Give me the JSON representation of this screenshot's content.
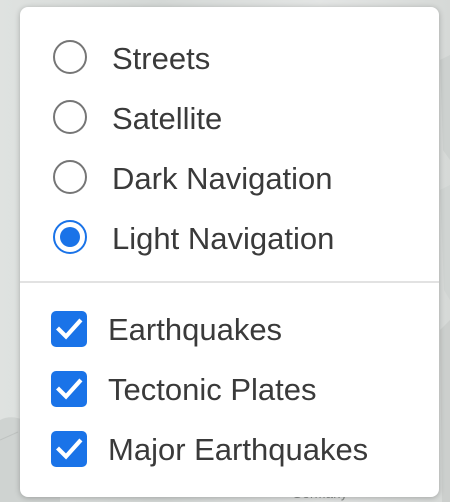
{
  "colors": {
    "accent": "#1a73e8",
    "text": "#3a3a3a",
    "panel_background": "#ffffff",
    "map_background": "#d7dad8"
  },
  "map": {
    "partial_label": "Germany"
  },
  "layer_control": {
    "base_layers": [
      {
        "label": "Streets",
        "selected": false
      },
      {
        "label": "Satellite",
        "selected": false
      },
      {
        "label": "Dark Navigation",
        "selected": false
      },
      {
        "label": "Light Navigation",
        "selected": true
      }
    ],
    "overlays": [
      {
        "label": "Earthquakes",
        "checked": true,
        "icon": "checkmark-icon"
      },
      {
        "label": "Tectonic Plates",
        "checked": true,
        "icon": "checkmark-icon"
      },
      {
        "label": "Major Earthquakes",
        "checked": true,
        "icon": "checkmark-icon"
      }
    ]
  }
}
